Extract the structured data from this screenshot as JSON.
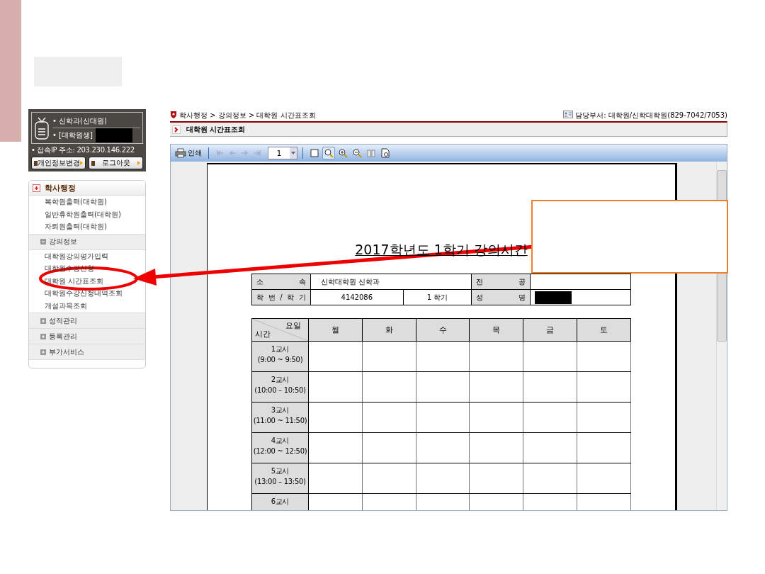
{
  "user_panel": {
    "department": "• 신학과(신대원)",
    "role": "• [대학원생]",
    "ip": "• 접속IP 주소: 203.230.146.222",
    "buttons": [
      "개인정보변경",
      "로그아웃"
    ]
  },
  "menu": [
    {
      "label": "학사행정",
      "kind": "root",
      "expanded": true,
      "children": [
        {
          "label": "복학원출력(대학원)"
        },
        {
          "label": "일반휴학원출력(대학원)"
        },
        {
          "label": "자퇴원출력(대학원)"
        }
      ]
    },
    {
      "label": "강의정보",
      "kind": "section",
      "expanded": true,
      "children": [
        {
          "label": "대학원강의평가입력"
        },
        {
          "label": "대학원수강신청"
        },
        {
          "label": "대학원 시간표조회"
        },
        {
          "label": "대학원수강신청내역조회"
        },
        {
          "label": "개설과목조회"
        }
      ]
    },
    {
      "label": "성적관리",
      "kind": "section",
      "expanded": false
    },
    {
      "label": "등록관리",
      "kind": "section",
      "expanded": false
    },
    {
      "label": "부가서비스",
      "kind": "section",
      "expanded": false
    }
  ],
  "breadcrumb": "학사행정 > 강의정보 > 대학원 시간표조회",
  "contact": "담당부서: 대학원/신학대학원(829-7042/7053)",
  "page_title": "대학원 시간표조회",
  "viewer": {
    "print_label": "인쇄",
    "page": "1",
    "nav": [
      {
        "kind": "first",
        "disabled": true
      },
      {
        "kind": "prev",
        "disabled": true
      },
      {
        "kind": "next",
        "disabled": true
      },
      {
        "kind": "last",
        "disabled": true
      }
    ],
    "tools": [
      {
        "kind": "page",
        "selected": false
      },
      {
        "kind": "zoom",
        "selected": true
      },
      {
        "kind": "zoom-in",
        "selected": false
      },
      {
        "kind": "zoom-out",
        "selected": false
      },
      {
        "kind": "two-page",
        "selected": false
      },
      {
        "kind": "preview",
        "selected": false
      }
    ]
  },
  "document": {
    "title": "2017학년도 1학기 강의시간",
    "info": [
      [
        "소 속",
        "신학대학원 신학과",
        "전 공"
      ],
      [
        "학 번 / 학 기",
        "4142086",
        "1 학기",
        "성 명"
      ]
    ],
    "corner_top": "요일",
    "corner_bottom": "시간",
    "days": [
      "월",
      "화",
      "수",
      "목",
      "금",
      "토"
    ],
    "periods": [
      {
        "label": "1교시",
        "time": "(9:00 ~ 9:50)"
      },
      {
        "label": "2교시",
        "time": "(10:00 – 10:50)"
      },
      {
        "label": "3교시",
        "time": "(11:00 ~ 11:50)"
      },
      {
        "label": "4교시",
        "time": "(12:00 ~ 12:50)"
      },
      {
        "label": "5교시",
        "time": "(13:00 – 13:50)"
      },
      {
        "label": "6교시"
      }
    ]
  }
}
